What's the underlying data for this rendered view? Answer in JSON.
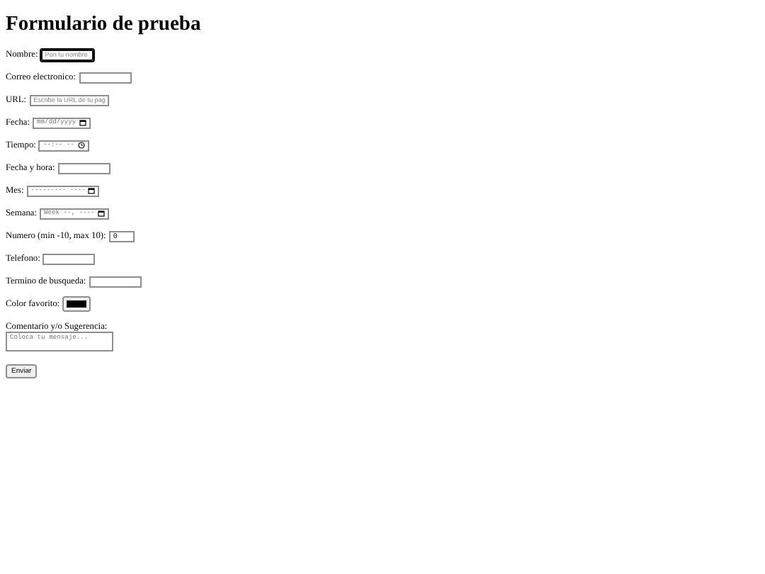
{
  "title": "Formulario de prueba",
  "fields": [
    {
      "label": "Nombre:",
      "kind": "text",
      "placeholder": "Pon tu nombre",
      "focused": true
    },
    {
      "label": "Correo electronico:",
      "kind": "text",
      "focused": false
    },
    {
      "label": "URL:",
      "kind": "text",
      "placeholder": "Escribe la URL de tu pag",
      "focused": false
    },
    {
      "label": "Fecha:",
      "kind": "date",
      "mask": "mm/dd/yyyy",
      "focused": false
    },
    {
      "label": "Tiempo:",
      "kind": "time",
      "mask": "--:-- --",
      "focused": false
    },
    {
      "label": "Fecha y hora:",
      "kind": "text",
      "focused": false
    },
    {
      "label": "Mes:",
      "kind": "date",
      "mask": "--------- ----",
      "focused": false
    },
    {
      "label": "Semana:",
      "kind": "date",
      "mask": "Week --, ----",
      "focused": false
    },
    {
      "label": "Numero (min -10, max 10):",
      "kind": "number",
      "value": "0",
      "focused": false
    },
    {
      "label": "Telefono:",
      "kind": "text",
      "focused": false
    },
    {
      "label": "Termino de busqueda:",
      "kind": "text",
      "focused": false
    },
    {
      "label": "Color favorito:",
      "kind": "color",
      "color": "#000000",
      "focused": false
    }
  ],
  "comment": {
    "label": "Comentario y/o Sugerencia:",
    "placeholder": "Coloca tu mensaje..."
  },
  "submit": "Enviar"
}
